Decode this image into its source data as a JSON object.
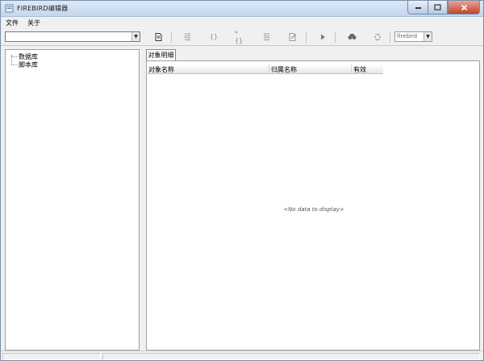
{
  "window": {
    "title": "FIREBIRD编辑器"
  },
  "menu": {
    "items": [
      {
        "label": "文件"
      },
      {
        "label": "关于"
      }
    ]
  },
  "toolbar": {
    "object_combo_value": "",
    "db_type_value": "firebird",
    "icons": [
      "new-document-icon",
      "indent-left-icon",
      "braces-left-icon",
      "braces-right-icon",
      "indent-right-icon",
      "edit-document-icon",
      "run-icon",
      "find-icon",
      "replace-icon"
    ]
  },
  "tree": {
    "items": [
      {
        "label": "数据库"
      },
      {
        "label": "脚本库"
      }
    ]
  },
  "details": {
    "tab_label": "对象明细",
    "columns": [
      "对象名称",
      "归属名称",
      "有效"
    ],
    "empty_text": "<No data to display>"
  }
}
